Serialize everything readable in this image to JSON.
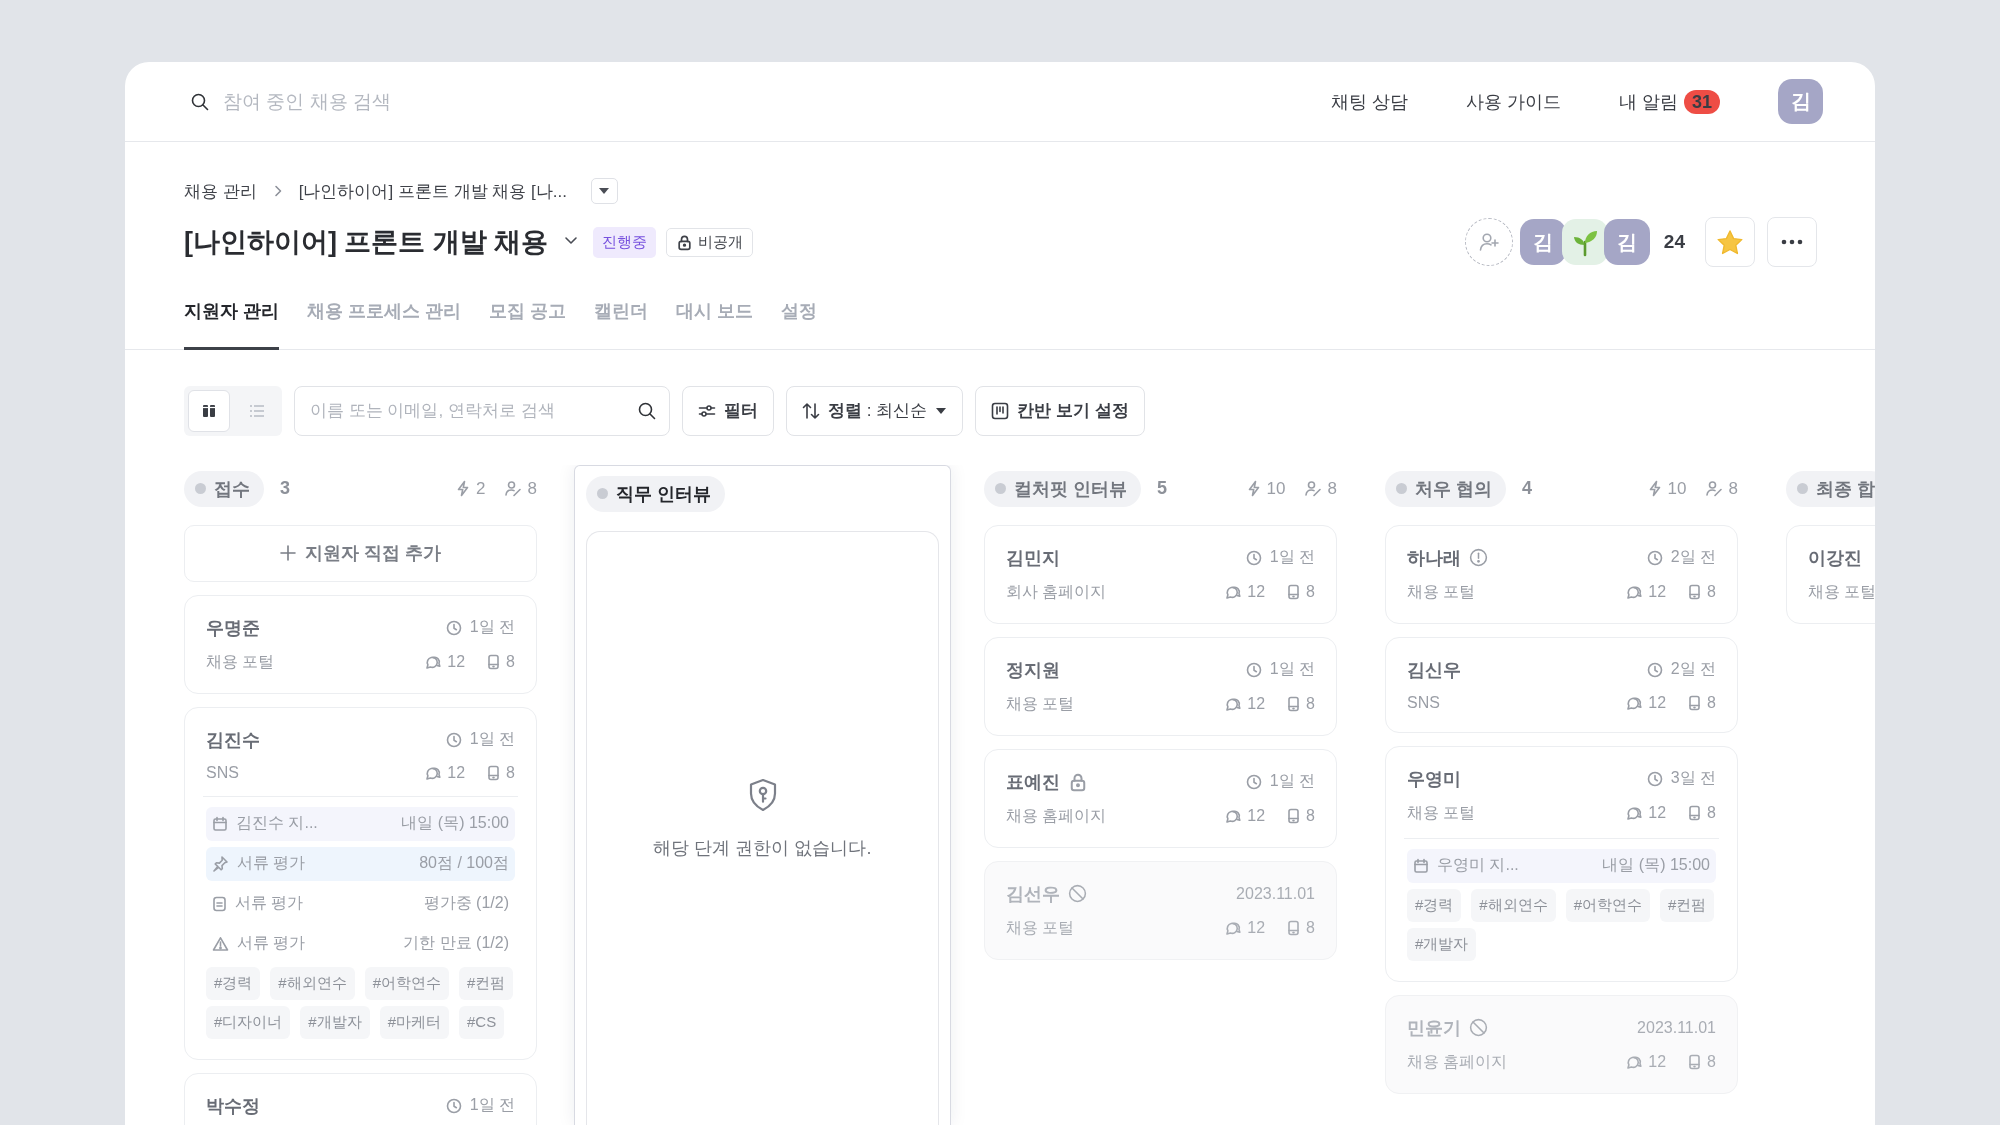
{
  "topbar": {
    "search_placeholder": "참여 중인 채용 검색",
    "links": [
      "채팅 상담",
      "사용 가이드"
    ],
    "notifications": {
      "label": "내 알림",
      "count": "31"
    },
    "avatar": "김"
  },
  "breadcrumb": [
    "채용 관리",
    "[나인하이어] 프론트 개발 채용 [나..."
  ],
  "job": {
    "title": "[나인하이어] 프론트 개발 채용",
    "status": "진행중",
    "visibility": "비공개",
    "members": [
      {
        "kind": "initial",
        "text": "김"
      },
      {
        "kind": "sprout"
      },
      {
        "kind": "initial",
        "text": "김"
      }
    ],
    "member_count": "24",
    "starred": true
  },
  "tabs": [
    {
      "label": "지원자 관리",
      "selected": true
    },
    {
      "label": "채용 프로세스 관리",
      "selected": false
    },
    {
      "label": "모집 공고",
      "selected": false
    },
    {
      "label": "캘린더",
      "selected": false
    },
    {
      "label": "대시 보드",
      "selected": false
    },
    {
      "label": "설정",
      "selected": false
    }
  ],
  "toolbar": {
    "views": [
      {
        "kind": "board",
        "selected": true
      },
      {
        "kind": "list",
        "selected": false
      }
    ],
    "search_placeholder": "이름 또는 이메일, 연락처로 검색",
    "filter": "필터",
    "sort": "**정렬** : 최신순",
    "board_settings": "칸반 보기 설정"
  },
  "columns": [
    {
      "kind": "stage",
      "title": "접수",
      "count": "3",
      "bolt": "2",
      "people": "8",
      "highlighted": false,
      "add_label": "지원자 직접 추가",
      "cards": [
        {
          "kind": "plain",
          "name": "우명준",
          "time": "1일 전",
          "source": "채용 포털",
          "comments": "12",
          "files": "8",
          "disabled": false
        },
        {
          "kind": "plain",
          "name": "김진수",
          "time": "1일 전",
          "source": "SNS",
          "comments": "12",
          "files": "8",
          "disabled": false,
          "schedule": {
            "title": "김진수 지...",
            "time": "내일 (목) 15:00"
          },
          "evaluations": [
            {
              "kind": "score",
              "label": "서류 평가",
              "value": "80점 / 100점"
            },
            {
              "kind": "progress",
              "label": "서류 평가",
              "value": "평가중 (1/2)"
            },
            {
              "kind": "expired",
              "label": "서류 평가",
              "value": "기한 만료 (1/2)"
            }
          ],
          "tags": [
            "#경력",
            "#해외연수",
            "#어학연수",
            "#컨펌",
            "#디자이너",
            "#개발자",
            "#마케터",
            "#CS"
          ]
        },
        {
          "kind": "plain",
          "name": "박수정",
          "time": "1일 전",
          "disabled": false
        }
      ]
    },
    {
      "kind": "restricted",
      "title": "직무 인터뷰",
      "highlighted": true,
      "message": "해당 단계 권한이 없습니다."
    },
    {
      "kind": "stage",
      "title": "컬처핏 인터뷰",
      "count": "5",
      "bolt": "10",
      "people": "8",
      "highlighted": false,
      "cards": [
        {
          "kind": "plain",
          "name": "김민지",
          "time": "1일 전",
          "source": "회사 홈페이지",
          "comments": "12",
          "files": "8",
          "disabled": false
        },
        {
          "kind": "plain",
          "name": "정지원",
          "time": "1일 전",
          "source": "채용 포털",
          "comments": "12",
          "files": "8",
          "disabled": false
        },
        {
          "kind": "locked",
          "name": "표예진",
          "time": "1일 전",
          "source": "채용 홈페이지",
          "comments": "12",
          "files": "8",
          "disabled": false
        },
        {
          "kind": "blocked",
          "name": "김선우",
          "time": "2023.11.01",
          "source": "채용 포털",
          "comments": "12",
          "files": "8",
          "disabled": true
        }
      ]
    },
    {
      "kind": "stage",
      "title": "처우 협의",
      "count": "4",
      "bolt": "10",
      "people": "8",
      "highlighted": false,
      "cards": [
        {
          "kind": "alert",
          "name": "하나래",
          "time": "2일 전",
          "source": "채용 포털",
          "comments": "12",
          "files": "8",
          "disabled": false
        },
        {
          "kind": "plain",
          "name": "김신우",
          "time": "2일 전",
          "source": "SNS",
          "comments": "12",
          "files": "8",
          "disabled": false
        },
        {
          "kind": "plain",
          "name": "우영미",
          "time": "3일 전",
          "source": "채용 포털",
          "comments": "12",
          "files": "8",
          "disabled": false,
          "schedule": {
            "title": "우영미 지...",
            "time": "내일 (목) 15:00"
          },
          "tags": [
            "#경력",
            "#해외연수",
            "#어학연수",
            "#컨펌",
            "#개발자"
          ]
        },
        {
          "kind": "blocked",
          "name": "민윤기",
          "time": "2023.11.01",
          "source": "채용 홈페이지",
          "comments": "12",
          "files": "8",
          "disabled": true
        }
      ]
    },
    {
      "kind": "stage",
      "title": "최종 합",
      "highlighted": false,
      "cards": [
        {
          "kind": "plain",
          "name": "이강진",
          "source": "채용 포털",
          "disabled": false
        }
      ]
    }
  ]
}
